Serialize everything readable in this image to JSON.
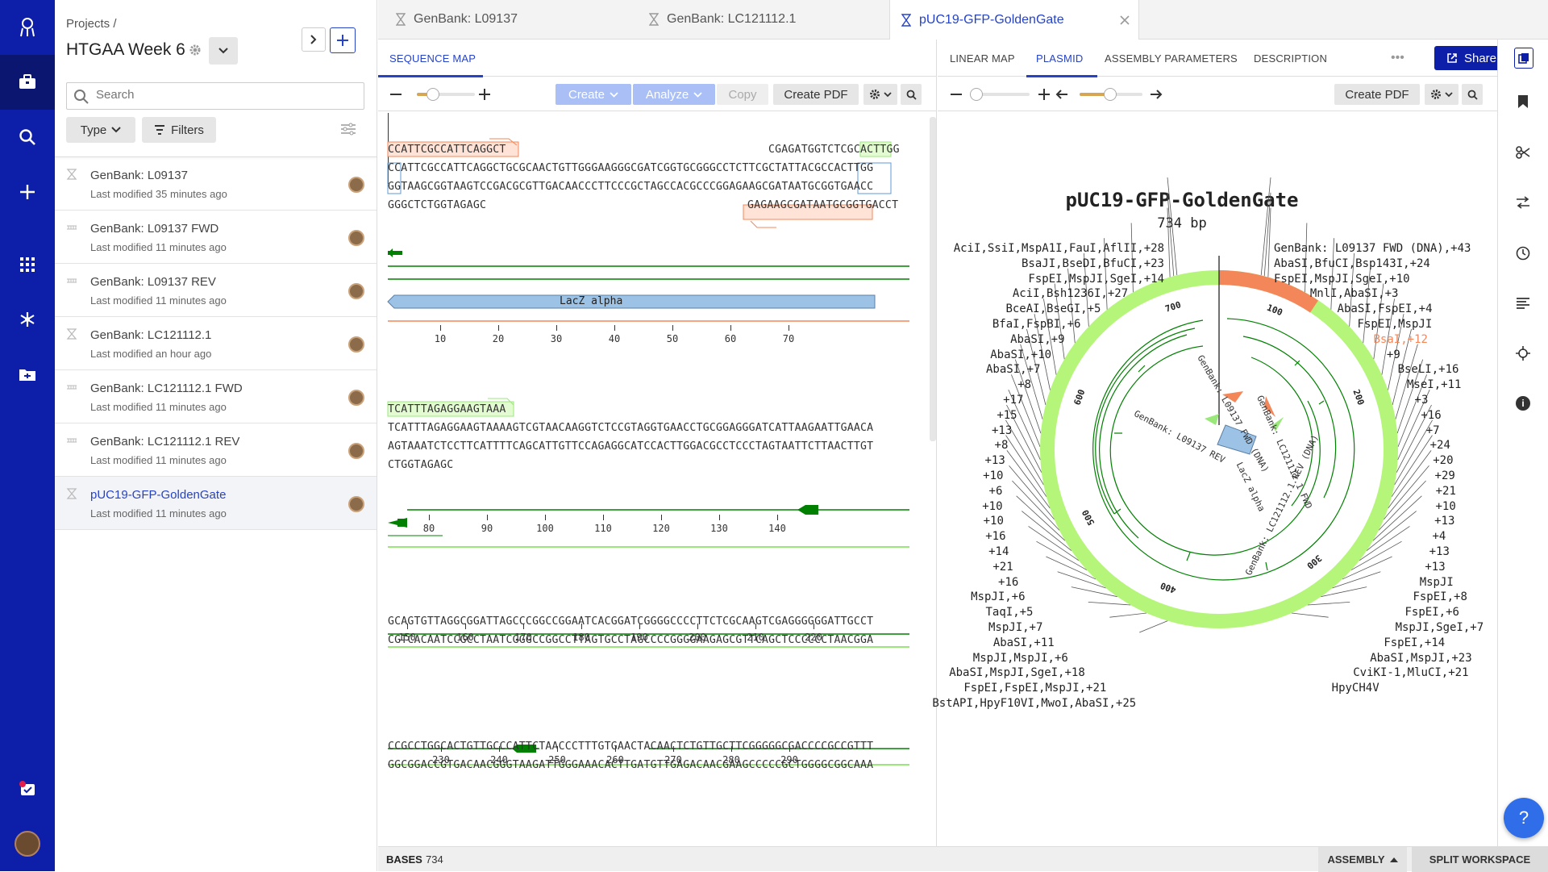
{
  "rail": {
    "icons": [
      "logo-icon",
      "briefcase-icon",
      "search-icon",
      "plus-icon",
      "apps-icon",
      "molecule-icon",
      "folder-icon",
      "tasks-icon",
      "user-avatar"
    ]
  },
  "project": {
    "breadcrumb": "Projects /",
    "title": "HTGAA Week 6",
    "search_placeholder": "Search",
    "type_label": "Type",
    "filters_label": "Filters",
    "items": [
      {
        "name": "GenBank: L09137",
        "modified": "Last modified 35 minutes ago"
      },
      {
        "name": "GenBank: L09137 FWD",
        "modified": "Last modified 11 minutes ago"
      },
      {
        "name": "GenBank: L09137 REV",
        "modified": "Last modified 11 minutes ago"
      },
      {
        "name": "GenBank: LC121112.1",
        "modified": "Last modified an hour ago"
      },
      {
        "name": "GenBank: LC121112.1 FWD",
        "modified": "Last modified 11 minutes ago"
      },
      {
        "name": "GenBank: LC121112.1 REV",
        "modified": "Last modified 11 minutes ago"
      },
      {
        "name": "pUC19-GFP-GoldenGate",
        "modified": "Last modified 11 minutes ago"
      }
    ]
  },
  "tabs": [
    "GenBank: L09137",
    "GenBank: LC121112.1",
    "pUC19-GFP-GoldenGate"
  ],
  "left_panel": {
    "tab": "SEQUENCE MAP",
    "create": "Create",
    "analyze": "Analyze",
    "copy": "Copy",
    "create_pdf": "Create PDF"
  },
  "seq": {
    "row1": {
      "primer_top": "CCATTCGCCATTCAGGCT",
      "primer_top2": "CGAGATGGTCTCGCA",
      "primer_top2_hl": "CTTGG",
      "fwd": "CCATTCGCCATTCAGGCTGCGCAACTGTTGGGAAGGGCGATCGGTGCGGGCCTCTTCGCTATTACGCCACTTGG",
      "rev": "GGTAAGCGGTAAGTCCGACGCGTTGACAACCCTTCCCGCTAGCCACGCCCGGAGAAGCGATAATGCGGTGAACC",
      "primer_bot": "GGGCTCTGGTAGAGC",
      "primer_bot2": "GAGAAGCGATAATGCGGT",
      "primer_bot2_tail": "GACCT",
      "feature": "LacZ alpha",
      "ticks": [
        "10",
        "20",
        "30",
        "40",
        "50",
        "60",
        "70"
      ]
    },
    "row2": {
      "primer_top": "TCATTTAGAGGAAGTAAA",
      "fwd": "TCATTTAGAGGAAGTAAAAGTCGTAACAAGGTCTCCGTAGGTGAACCTGCGGAGGGATCATTAAGAATTGAACA",
      "rev": "AGTAAATCTCCTTCATTTTCAGCATTGTTCCAGAGGCATCCACTTGGACGCCTCCCTAGTAATTCTTAACTTGT",
      "primer_bot": "CTGGTAGAGC",
      "ticks": [
        "80",
        "90",
        "100",
        "110",
        "120",
        "130",
        "140"
      ]
    },
    "row3": {
      "fwd": "GCAGTGTTAGGCGGATTAGCCCGGCCGGAATCACGGATCGGGGCCCCTTCTCGCAAGTCGAGGGGGGATTGCCT",
      "rev": "CGTCACAATCCGCCTAATCGGGCCGGCCTTAGTGCCTAGCCCCGGGGAAGAGCGTTCAGCTCCCCCCTAACGGA",
      "ticks": [
        "150",
        "160",
        "170",
        "180",
        "190",
        "200",
        "210",
        "220"
      ]
    },
    "row4": {
      "fwd": "CCGCCTGGCACTGTTGCCCATTCTAACCCTTTGTGAACTACAACTCTGTTGCTTCGGGGGCGACCCCGCCGTTT",
      "rev": "GGCGGACCGTGACAACGGGTAAGATTGGGAAACACTTGATGTTGAGACAACGAAGCCCCCGCTGGGGCGGCAAA",
      "ticks": [
        "230",
        "240",
        "250",
        "260",
        "270",
        "280",
        "290"
      ]
    }
  },
  "footer": {
    "bases_label": "BASES",
    "bases": "734",
    "assembly": "ASSEMBLY",
    "split": "SPLIT WORKSPACE"
  },
  "right_panel": {
    "tabs": [
      "LINEAR MAP",
      "PLASMID",
      "ASSEMBLY PARAMETERS",
      "DESCRIPTION"
    ],
    "share": "Share",
    "create_pdf": "Create PDF"
  },
  "plasmid": {
    "name": "pUC19-GFP-GoldenGate",
    "length": "734 bp",
    "ring_ticks": [
      "700",
      "100",
      "200",
      "300",
      "400",
      "500",
      "600"
    ],
    "inner_labels": [
      "GenBank: L09137 FWD (DNA)",
      "GenBank: LC121112.1 FWD",
      "LacZ alpha",
      "GenBank: LC121112.1 REV (DNA)",
      "GenBank: L09137 REV"
    ],
    "left_labels": [
      "AciI,SsiI,MspA1I,FauI,AflII,+28",
      "BsaJI,BseDI,BfuCI,+23",
      "FspEI,MspJI,SgeI,+14",
      "AciI,Bsh1236I,+27",
      "BceAI,BseGI,+5",
      "BfaI,FspBI,+6",
      "AbaSI,+9",
      "AbaSI,+10",
      "AbaSI,+7",
      "+8",
      "+17",
      "+15",
      "+13",
      "+8",
      "+13",
      "+10",
      "+6",
      "+10",
      "+10",
      "+16",
      "+14",
      "+21",
      "+16",
      "MspJI,+6",
      "TaqI,+5",
      "MspJI,+7",
      "AbaSI,+11",
      "MspJI,MspJI,+6",
      "AbaSI,MspJI,SgeI,+18",
      "FspEI,FspEI,MspJI,+21",
      "BstAPI,HpyF10VI,MwoI,AbaSI,+25"
    ],
    "right_labels": [
      "GenBank: L09137 FWD (DNA),+43",
      "AbaSI,BfuCI,Bsp143I,+24",
      "FspEI,MspJI,SgeI,+10",
      "MnlI,AbaSI,+3",
      "AbaSI,FspEI,+4",
      "FspEI,MspJI",
      "BsaI,+12",
      "+9",
      "BseLI,+16",
      "MseI,+11",
      "+3",
      "+16",
      "+7",
      "+24",
      "+20",
      "+29",
      "+21",
      "+10",
      "+13",
      "+4",
      "+13",
      "+13",
      "MspJI",
      "FspEI,+8",
      "FspEI,+6",
      "MspJI,SgeI,+7",
      "FspEI,+14",
      "AbaSI,MspJI,+23",
      "CviKI-1,MluCI,+21",
      "HpyCH4V"
    ]
  },
  "colors": {
    "rail": "#0d1fa8",
    "accent": "#2643c6",
    "backbone": "#b5f57a",
    "insert": "#f4875a",
    "feature": "#9cc3e6",
    "primer_green": "#9be87a",
    "primer_red": "#f4875a",
    "dark_green": "#008000"
  }
}
